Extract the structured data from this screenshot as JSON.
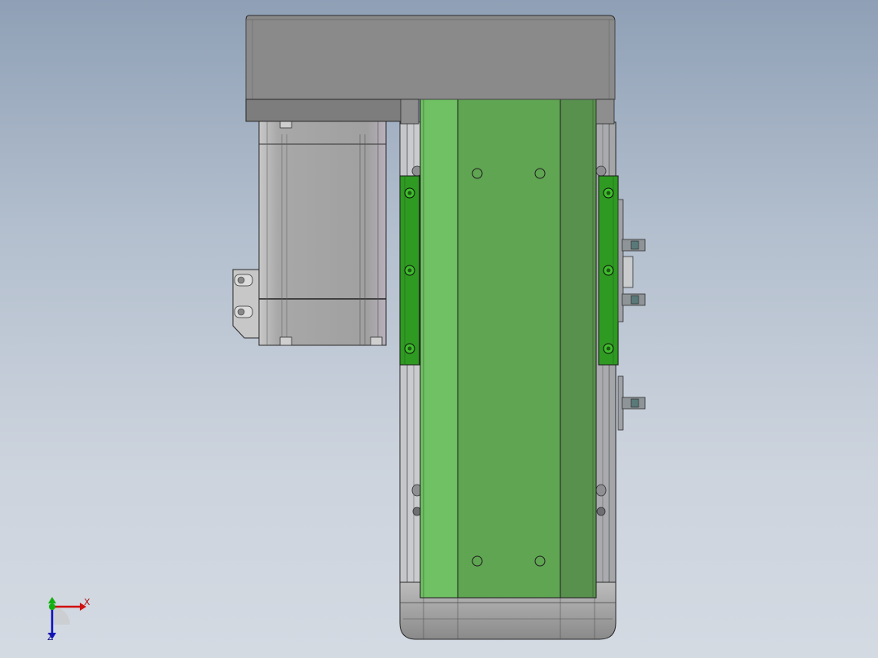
{
  "colors": {
    "background_top": "#8fa0b6",
    "background_bottom": "#d4dae2",
    "motor_housing": "#8a8a8a",
    "motor_body": "#a9a9a9",
    "carriage_green": "#5fa552",
    "carriage_green_light": "#6fc163",
    "carriage_green_dark": "#58904d",
    "rail_green": "#2f9a22",
    "frame_gray": "#b7b9bc",
    "outline": "#2a2a2a",
    "axis_x": "#d01010",
    "axis_y": "#10b010",
    "axis_z": "#1010c0"
  },
  "triad": {
    "x_label": "X",
    "z_label": "Z"
  }
}
